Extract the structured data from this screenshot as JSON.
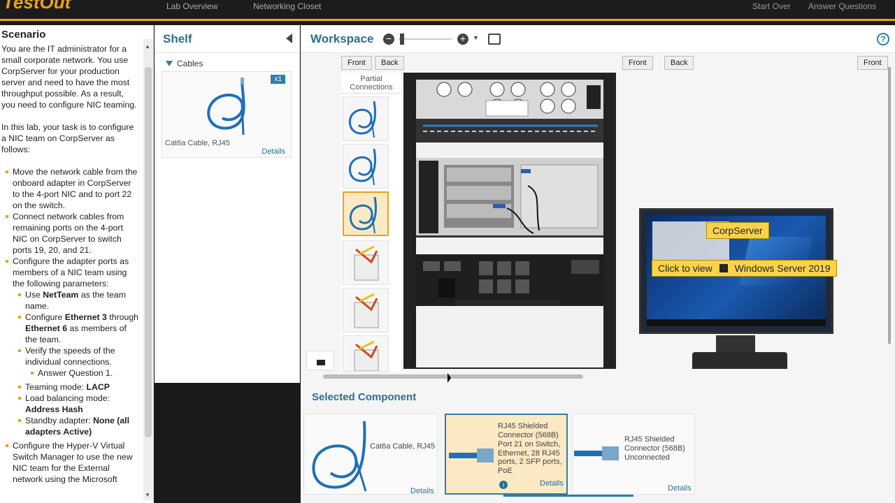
{
  "topbar": {
    "logo": "TestOut",
    "tab1": "Lab Overview",
    "tab2": "Networking Closet",
    "btn1": "Start Over",
    "btn2": "Answer Questions"
  },
  "scenario": {
    "title": "Scenario",
    "p1": "You are the IT administrator for a small corporate network. You use CorpServer for your production server and need to have the most throughput possible. As a result, you need to configure NIC teaming.",
    "p2": "In this lab, your task is to configure a NIC team on CorpServer as follows:",
    "item1": "Move the network cable from the onboard adapter in CorpServer to the 4-port NIC and to port 22 on the switch.",
    "item2": "Connect network cables from remaining ports on the 4-port NIC on CorpServer to switch ports 19, 20, and 21.",
    "item3": "Configure the adapter ports as members of a NIC team using the following parameters:",
    "sub1_a": "Use ",
    "sub1_b": "NetTeam",
    "sub1_c": " as the team name.",
    "sub2_a": "Configure ",
    "sub2_b": "Ethernet 3",
    "sub2_c": " through ",
    "sub2_d": "Ethernet 6",
    "sub2_e": " as members of the team.",
    "sub3": "Verify the speeds of the individual connections.",
    "subsub1": "Answer Question 1.",
    "sub4_a": "Teaming mode: ",
    "sub4_b": "LACP",
    "sub5_a": "Load balancing mode: ",
    "sub5_b": "Address Hash",
    "sub6_a": "Standby adapter: ",
    "sub6_b": "None (all adapters Active)",
    "item4": "Configure the Hyper-V Virtual Switch Manager to use the new NIC team for the External network using the Microsoft"
  },
  "shelf": {
    "title": "Shelf",
    "category": "Cables",
    "card": {
      "badge": "x1",
      "name": "Cat6a Cable, RJ45",
      "details": "Details"
    }
  },
  "workspace": {
    "title": "Workspace",
    "front": "Front",
    "back": "Back",
    "partial": "Partial Connections",
    "server_label": "CorpServer",
    "click_to_view": "Click to view",
    "os": "Windows Server 2019",
    "help": "?"
  },
  "selected": {
    "title": "Selected Component",
    "card1": {
      "name": "Cat6a Cable, RJ45",
      "details": "Details"
    },
    "card2": {
      "name": "RJ45 Shielded Connector (568B)",
      "port": "Port 21 on Switch, Ethernet, 28 RJ45 ports, 2 SFP ports, PoE",
      "details": "Details"
    },
    "card3": {
      "name": "RJ45 Shielded Connector (568B)",
      "status": "Unconnected",
      "details": "Details"
    }
  },
  "colors": {
    "accent": "#e8a21f",
    "link": "#2a6f8f",
    "selected_bg": "#fbe9c4"
  }
}
